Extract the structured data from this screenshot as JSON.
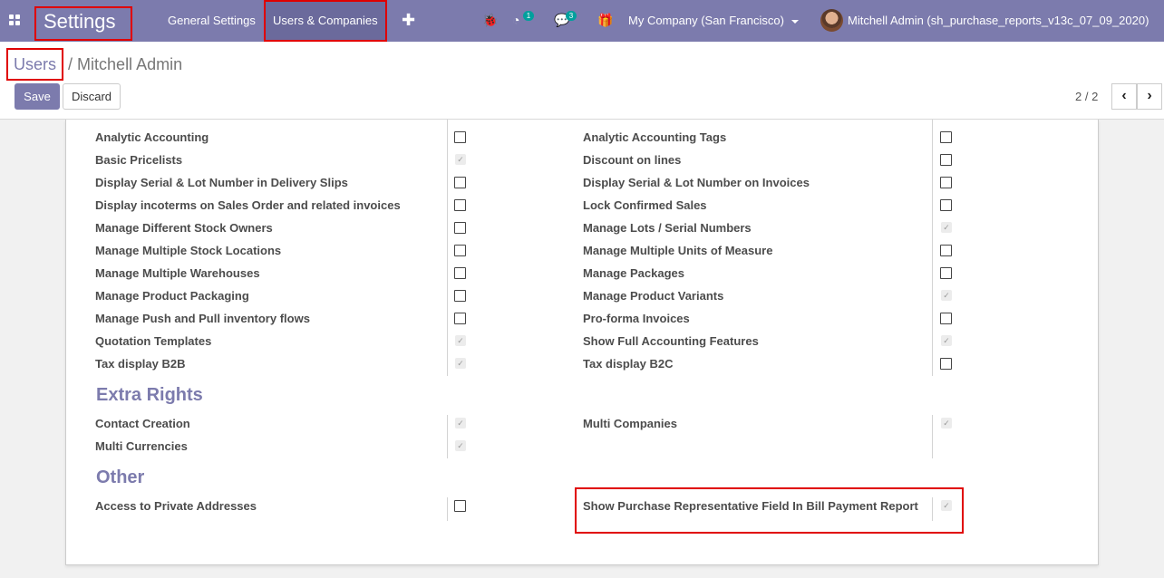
{
  "navbar": {
    "brand": "Settings",
    "menu": [
      "General Settings",
      "Users & Companies"
    ],
    "activity_count": "1",
    "messages_count": "3",
    "company": "My Company (San Francisco)",
    "user": "Mitchell Admin (sh_purchase_reports_v13c_07_09_2020)"
  },
  "breadcrumb": {
    "parent": "Users",
    "separator": "/",
    "current": "Mitchell Admin"
  },
  "buttons": {
    "save": "Save",
    "discard": "Discard"
  },
  "pager": {
    "value": "2 / 2"
  },
  "sections": {
    "technical_rows": [
      {
        "left": "Analytic Accounting",
        "left_checked": false,
        "right": "Analytic Accounting Tags",
        "right_checked": false
      },
      {
        "left": "Basic Pricelists",
        "left_checked": true,
        "right": "Discount on lines",
        "right_checked": false
      },
      {
        "left": "Display Serial & Lot Number in Delivery Slips",
        "left_checked": false,
        "right": "Display Serial & Lot Number on Invoices",
        "right_checked": false
      },
      {
        "left": "Display incoterms on Sales Order and related invoices",
        "left_checked": false,
        "right": "Lock Confirmed Sales",
        "right_checked": false
      },
      {
        "left": "Manage Different Stock Owners",
        "left_checked": false,
        "right": "Manage Lots / Serial Numbers",
        "right_checked": true
      },
      {
        "left": "Manage Multiple Stock Locations",
        "left_checked": false,
        "right": "Manage Multiple Units of Measure",
        "right_checked": false
      },
      {
        "left": "Manage Multiple Warehouses",
        "left_checked": false,
        "right": "Manage Packages",
        "right_checked": false
      },
      {
        "left": "Manage Product Packaging",
        "left_checked": false,
        "right": "Manage Product Variants",
        "right_checked": true
      },
      {
        "left": "Manage Push and Pull inventory flows",
        "left_checked": false,
        "right": "Pro-forma Invoices",
        "right_checked": false
      },
      {
        "left": "Quotation Templates",
        "left_checked": true,
        "right": "Show Full Accounting Features",
        "right_checked": true
      },
      {
        "left": "Tax display B2B",
        "left_checked": true,
        "right": "Tax display B2C",
        "right_checked": false
      }
    ],
    "extra_rights": {
      "title": "Extra Rights",
      "rows": [
        {
          "left": "Contact Creation",
          "left_checked": true,
          "right": "Multi Companies",
          "right_checked": true
        },
        {
          "left": "Multi Currencies",
          "left_checked": true
        }
      ]
    },
    "other": {
      "title": "Other",
      "rows": [
        {
          "left": "Access to Private Addresses",
          "left_checked": false,
          "right": "Show Purchase Representative Field In Bill Payment Report",
          "right_checked": true
        }
      ]
    }
  },
  "colors": {
    "brand": "#7c7bad",
    "highlight": "#e00000",
    "badge": "#00a09d"
  }
}
